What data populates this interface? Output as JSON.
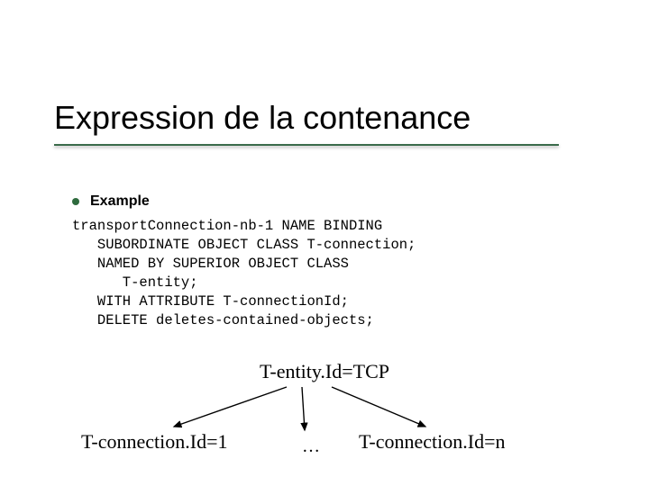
{
  "title": "Expression de la contenance",
  "bullet_label": "Example",
  "code_lines": [
    "transportConnection-nb-1 NAME BINDING",
    "   SUBORDINATE OBJECT CLASS T-connection;",
    "   NAMED BY SUPERIOR OBJECT CLASS",
    "      T-entity;",
    "   WITH ATTRIBUTE T-connectionId;",
    "   DELETE deletes-contained-objects;"
  ],
  "tree": {
    "root": "T-entity.Id=TCP",
    "left": "T-connection.Id=1",
    "dots": "…",
    "right": "T-connection.Id=n"
  }
}
